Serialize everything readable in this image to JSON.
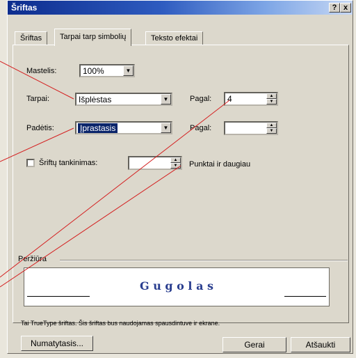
{
  "window": {
    "title": "Šriftas",
    "help": "?",
    "close": "x"
  },
  "tabs": [
    {
      "label": "Šriftas"
    },
    {
      "label": "Tarpai tarp simbolių"
    },
    {
      "label": "Teksto efektai"
    }
  ],
  "form": {
    "scale_label": "Mastelis:",
    "scale_value": "100%",
    "spacing_label": "Tarpai:",
    "spacing_value": "Išplėstas",
    "spacing_by_label": "Pagal:",
    "spacing_by_value": "4",
    "position_label": "Padėtis:",
    "position_value": "Įprastasis",
    "position_by_label": "Pagal:",
    "position_by_value": "",
    "kerning_label": "Šriftų tankinimas:",
    "kerning_value": "",
    "kerning_suffix": "Punktai ir daugiau"
  },
  "preview": {
    "group_label": "Peržiūra",
    "sample_text": "G u g o l a s",
    "note": "Tai TrueType šriftas. Šis šriftas bus naudojamas spausdintuve ir ekrane."
  },
  "buttons": {
    "default": "Numatytasis...",
    "ok": "Gerai",
    "cancel": "Atšaukti"
  },
  "colors": {
    "accent_text": "#2a3e8f",
    "annotation_line": "#d42020",
    "selection": "#0a246a"
  }
}
